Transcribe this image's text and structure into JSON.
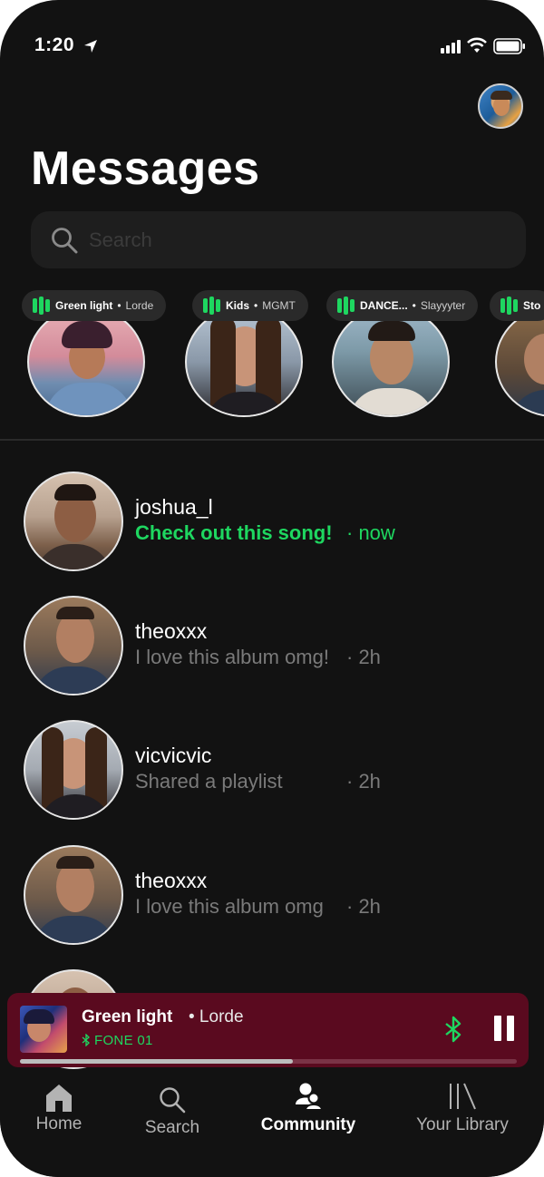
{
  "status_bar": {
    "time": "1:20"
  },
  "header": {
    "title": "Messages"
  },
  "search": {
    "placeholder": "Search"
  },
  "stories": [
    {
      "song": "Green light",
      "artist": "Lorde"
    },
    {
      "song": "Kids",
      "artist": "MGMT"
    },
    {
      "song": "DANCE...",
      "artist": "Slayyyter"
    },
    {
      "song": "Sto",
      "artist": ""
    }
  ],
  "messages": [
    {
      "username": "joshua_l",
      "preview": "Check out this song!",
      "time": "· now",
      "unread": true
    },
    {
      "username": "theoxxx",
      "preview": "I love this album omg!",
      "time": "· 2h",
      "unread": false
    },
    {
      "username": "vicvicvic",
      "preview": "Shared a playlist",
      "time": "· 2h",
      "unread": false
    },
    {
      "username": "theoxxx",
      "preview": "I love this album omg",
      "time": "· 2h",
      "unread": false
    }
  ],
  "now_playing": {
    "song": "Green light",
    "artist": "• Lorde",
    "device": "FONE 01",
    "progress": 0.55
  },
  "tabs": {
    "home": "Home",
    "search": "Search",
    "community": "Community",
    "library": "Your Library"
  },
  "colors": {
    "accent": "#1ed760",
    "background": "#121212",
    "player": "#5a0a1f"
  },
  "icons": [
    "location-arrow-icon",
    "signal-icon",
    "wifi-icon",
    "battery-icon",
    "search-icon",
    "equalizer-icon",
    "bluetooth-icon",
    "pause-icon",
    "home-icon",
    "community-icon",
    "library-icon"
  ]
}
